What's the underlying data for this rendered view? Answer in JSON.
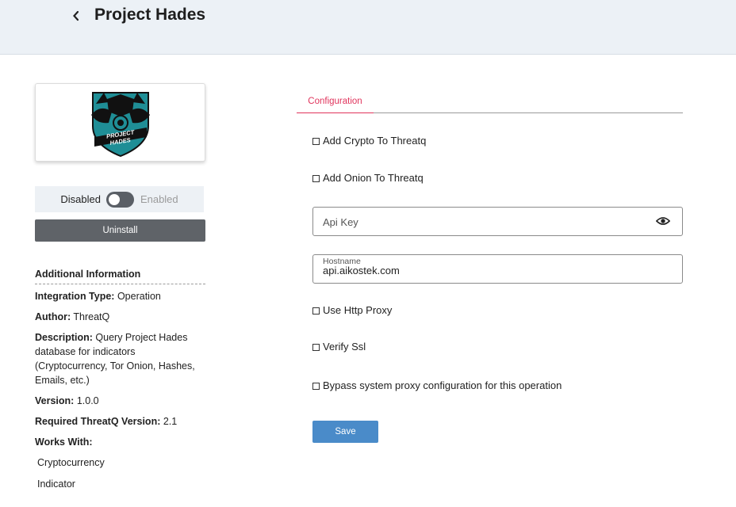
{
  "header": {
    "title": "Project Hades"
  },
  "logo": {
    "line1": "PROJECT",
    "line2": "HADES"
  },
  "status_toggle": {
    "off_label": "Disabled",
    "on_label": "Enabled",
    "enabled": false
  },
  "uninstall_label": "Uninstall",
  "additional_info": {
    "heading": "Additional Information",
    "integration_type_label": "Integration Type:",
    "integration_type": "Operation",
    "author_label": "Author:",
    "author": "ThreatQ",
    "description_label": "Description:",
    "description": "Query Project Hades database for indicators (Cryptocurrency, Tor Onion, Hashes, Emails, etc.)",
    "version_label": "Version:",
    "version": "1.0.0",
    "required_version_label": "Required ThreatQ Version:",
    "required_version": "2.1",
    "works_with_label": "Works With:",
    "works_with": [
      "Cryptocurrency",
      "Indicator"
    ]
  },
  "tabs": [
    {
      "label": "Configuration",
      "active": true
    }
  ],
  "config": {
    "add_crypto": {
      "label": "Add Crypto To Threatq",
      "checked": false
    },
    "add_onion": {
      "label": "Add Onion To Threatq",
      "checked": false
    },
    "api_key": {
      "placeholder": "Api Key",
      "icon": "eye-icon"
    },
    "hostname": {
      "label": "Hostname",
      "value": "api.aikostek.com"
    },
    "use_http_proxy": {
      "label": "Use Http Proxy",
      "checked": false
    },
    "verify_ssl": {
      "label": "Verify Ssl",
      "checked": false
    },
    "bypass_proxy": {
      "label": "Bypass system proxy configuration for this operation",
      "checked": false
    },
    "save_label": "Save"
  },
  "colors": {
    "header_bg": "#ecf1f6",
    "accent_tab": "#e0345c",
    "save_button": "#4a8bc9",
    "uninstall_button": "#5f6368",
    "logo_teal": "#1f8e96"
  }
}
